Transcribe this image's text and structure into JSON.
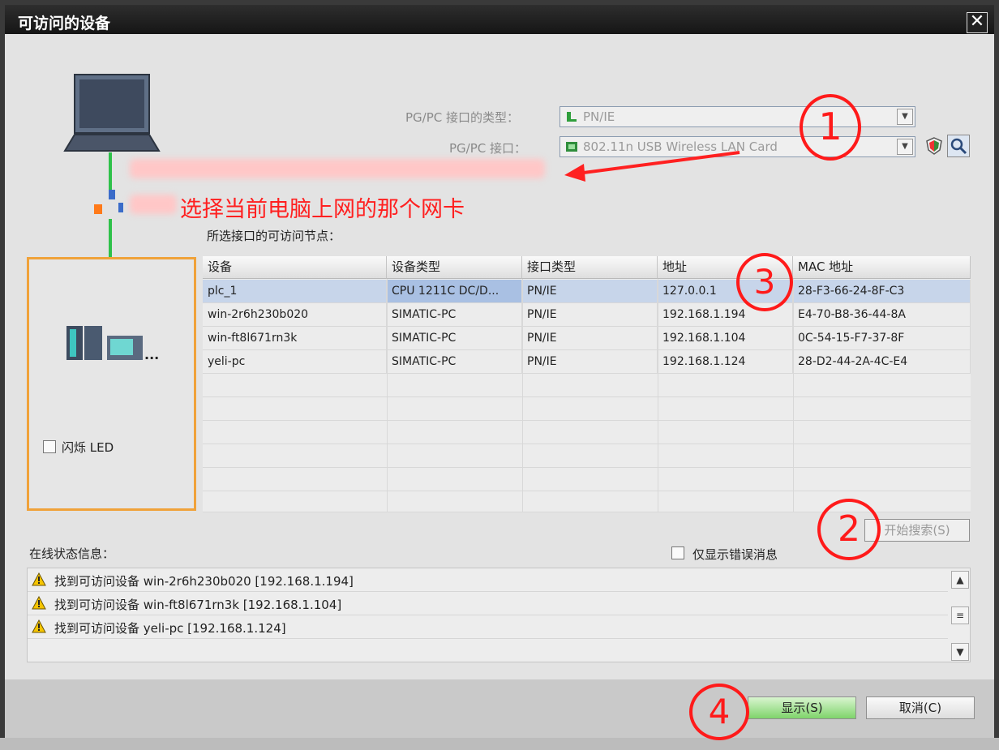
{
  "window": {
    "title": "可访问的设备",
    "close_glyph": "✕"
  },
  "interface": {
    "type_label": "PG/PC 接口的类型：",
    "type_value": "PN/IE",
    "port_label": "PG/PC 接口：",
    "port_value": "802.11n USB Wireless LAN Card"
  },
  "annotation": {
    "text": "选择当前电脑上网的那个网卡",
    "color": "#ff2020"
  },
  "nodes_label": "所选接口的可访问节点：",
  "left_panel": {
    "flash_led_label": "闪烁 LED",
    "device_more": "..."
  },
  "table": {
    "headers": [
      "设备",
      "设备类型",
      "接口类型",
      "地址",
      "MAC 地址"
    ],
    "rows": [
      {
        "device": "plc_1",
        "type": "CPU 1211C DC/D...",
        "iface": "PN/IE",
        "address": "127.0.0.1",
        "mac": "28-F3-66-24-8F-C3",
        "selected": true
      },
      {
        "device": "win-2r6h230b020",
        "type": "SIMATIC-PC",
        "iface": "PN/IE",
        "address": "192.168.1.194",
        "mac": "E4-70-B8-36-44-8A",
        "selected": false
      },
      {
        "device": "win-ft8l671rn3k",
        "type": "SIMATIC-PC",
        "iface": "PN/IE",
        "address": "192.168.1.104",
        "mac": "0C-54-15-F7-37-8F",
        "selected": false
      },
      {
        "device": "yeli-pc",
        "type": "SIMATIC-PC",
        "iface": "PN/IE",
        "address": "192.168.1.124",
        "mac": "28-D2-44-2A-4C-E4",
        "selected": false
      }
    ]
  },
  "search_button": "开始搜索(S)",
  "status": {
    "label": "在线状态信息：",
    "errors_only_label": "仅显示错误消息",
    "messages": [
      "找到可访问设备 win-2r6h230b020 [192.168.1.194]",
      "找到可访问设备 win-ft8l671rn3k [192.168.1.104]",
      "找到可访问设备 yeli-pc [192.168.1.124]"
    ]
  },
  "buttons": {
    "show": "显示(S)",
    "cancel": "取消(C)"
  },
  "markers": [
    "1",
    "2",
    "3",
    "4"
  ]
}
